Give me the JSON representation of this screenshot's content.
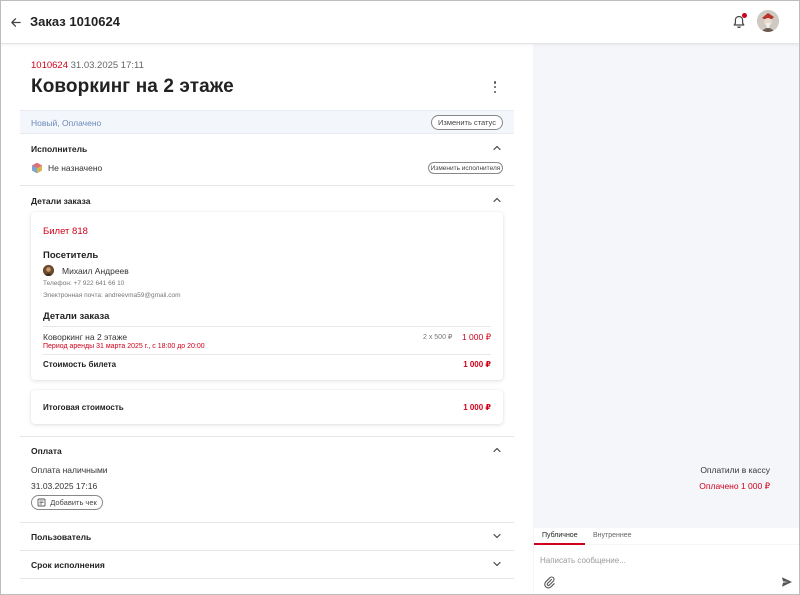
{
  "header": {
    "title": "Заказ 1010624"
  },
  "order": {
    "number": "1010624",
    "datetime": "31.03.2025 17:11",
    "title": "Коворкинг на 2 этаже"
  },
  "status": {
    "text": "Новый, Оплачено",
    "change_label": "Изменить статус"
  },
  "executor": {
    "section_title": "Исполнитель",
    "value": "Не назначено",
    "change_label": "Изменить исполнителя"
  },
  "order_details": {
    "section_title": "Детали заказа",
    "ticket": "Билет 818",
    "visitor_heading": "Посетитель",
    "visitor_name": "Михаил Андреев",
    "phone": "Телефон: +7 922 641 66 10",
    "email": "Электронная почта: andreevma59@gmail.com",
    "details_heading": "Детали заказа",
    "item_name": "Коворкинг на 2 этаже",
    "item_period": "Период аренды 31 марта 2025 г., с 18:00 до 20:00",
    "item_qty": "2 x 500 ₽",
    "item_price": "1 000 ₽",
    "ticket_cost_label": "Стоимость билета",
    "ticket_cost_value": "1 000 ₽",
    "total_label": "Итоговая стоимость",
    "total_value": "1 000 ₽"
  },
  "payment": {
    "section_title": "Оплата",
    "method": "Оплата наличными",
    "status": "Оплатили в кассу",
    "date": "31.03.2025 17:16",
    "paid": "Оплачено 1 000 ₽",
    "add_receipt_label": "Добавить чек"
  },
  "user_section": {
    "title": "Пользователь"
  },
  "deadline_section": {
    "title": "Срок исполнения"
  },
  "chat": {
    "tab_public": "Публичное",
    "tab_internal": "Внутреннее",
    "placeholder": "Написать сообщение..."
  },
  "colors": {
    "accent": "#d0021b",
    "status_text": "#6b8ab8",
    "status_bg": "#f3f6fb",
    "right_panel_bg": "#f5f6fa"
  },
  "icons": {
    "back": "arrow-left-icon",
    "bell": "bell-icon",
    "more": "kebab-menu-icon",
    "chevron_up": "chevron-up-icon",
    "chevron_down": "chevron-down-icon",
    "receipt": "receipt-icon",
    "attach": "paperclip-icon",
    "send": "send-icon"
  }
}
